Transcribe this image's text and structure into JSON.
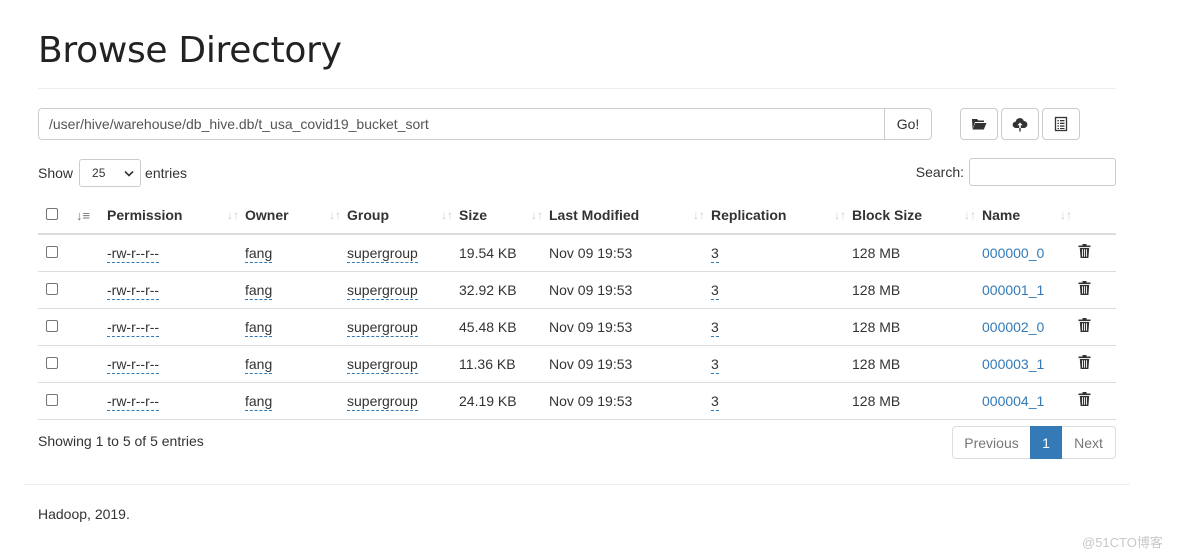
{
  "page": {
    "title": "Browse Directory"
  },
  "path_bar": {
    "value": "/user/hive/warehouse/db_hive.db/t_usa_covid19_bucket_sort",
    "go_label": "Go!"
  },
  "toolbar": {
    "buttons": [
      {
        "name": "create-directory",
        "icon": "folder-open-icon"
      },
      {
        "name": "upload",
        "icon": "cloud-upload-icon"
      },
      {
        "name": "cut-paste",
        "icon": "list-alt-icon"
      }
    ]
  },
  "length_menu": {
    "show_label": "Show",
    "selected": "25",
    "entries_label": "entries"
  },
  "search": {
    "label": "Search:",
    "value": ""
  },
  "table": {
    "columns": [
      "Permission",
      "Owner",
      "Group",
      "Size",
      "Last Modified",
      "Replication",
      "Block Size",
      "Name"
    ],
    "rows": [
      {
        "permission": "-rw-r--r--",
        "owner": "fang",
        "group": "supergroup",
        "size": "19.54 KB",
        "modified": "Nov 09 19:53",
        "replication": "3",
        "block_size": "128 MB",
        "name": "000000_0"
      },
      {
        "permission": "-rw-r--r--",
        "owner": "fang",
        "group": "supergroup",
        "size": "32.92 KB",
        "modified": "Nov 09 19:53",
        "replication": "3",
        "block_size": "128 MB",
        "name": "000001_1"
      },
      {
        "permission": "-rw-r--r--",
        "owner": "fang",
        "group": "supergroup",
        "size": "45.48 KB",
        "modified": "Nov 09 19:53",
        "replication": "3",
        "block_size": "128 MB",
        "name": "000002_0"
      },
      {
        "permission": "-rw-r--r--",
        "owner": "fang",
        "group": "supergroup",
        "size": "11.36 KB",
        "modified": "Nov 09 19:53",
        "replication": "3",
        "block_size": "128 MB",
        "name": "000003_1"
      },
      {
        "permission": "-rw-r--r--",
        "owner": "fang",
        "group": "supergroup",
        "size": "24.19 KB",
        "modified": "Nov 09 19:53",
        "replication": "3",
        "block_size": "128 MB",
        "name": "000004_1"
      }
    ]
  },
  "table_info": "Showing 1 to 5 of 5 entries",
  "pagination": {
    "previous": "Previous",
    "current": "1",
    "next": "Next"
  },
  "footer": {
    "text": "Hadoop, 2019."
  },
  "watermark": "@51CTO博客",
  "colors": {
    "accent": "#337ab7",
    "border": "#dddddd",
    "text": "#333333"
  }
}
